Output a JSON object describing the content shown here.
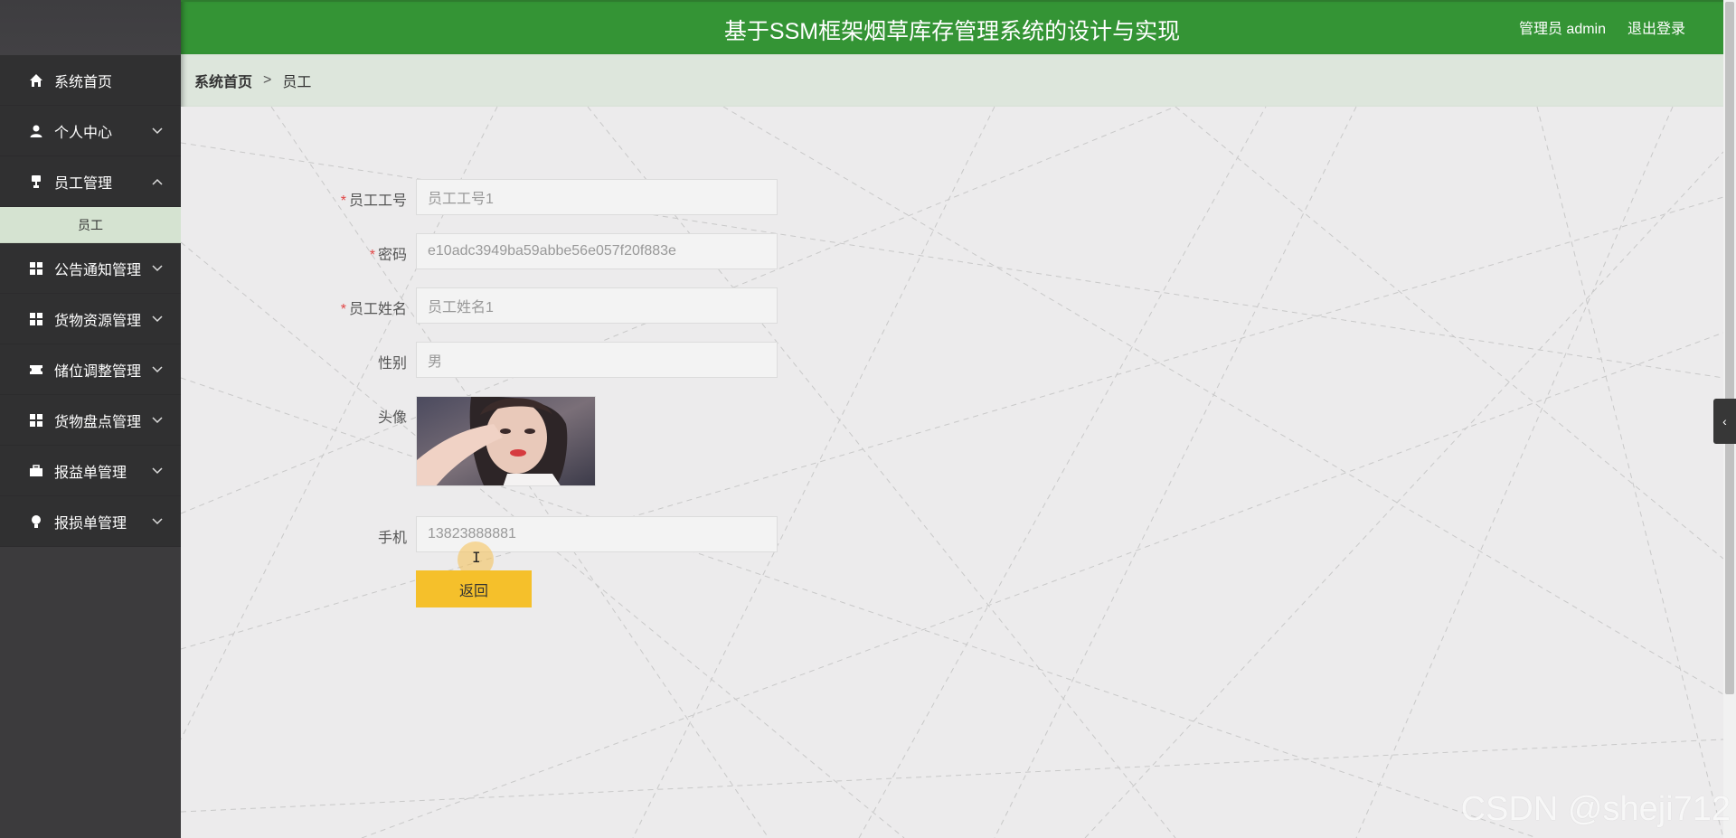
{
  "header": {
    "title": "基于SSM框架烟草库存管理系统的设计与实现",
    "user": "管理员 admin",
    "logout": "退出登录"
  },
  "sidebar": {
    "items": [
      {
        "label": "系统首页",
        "icon": "home-icon",
        "expanded": null
      },
      {
        "label": "个人中心",
        "icon": "user-icon",
        "expanded": false
      },
      {
        "label": "员工管理",
        "icon": "trophy-icon",
        "expanded": true
      },
      {
        "label": "公告通知管理",
        "icon": "grid-icon",
        "expanded": false
      },
      {
        "label": "货物资源管理",
        "icon": "grid-icon",
        "expanded": false
      },
      {
        "label": "储位调整管理",
        "icon": "ticket-icon",
        "expanded": false
      },
      {
        "label": "货物盘点管理",
        "icon": "grid-icon",
        "expanded": false
      },
      {
        "label": "报益单管理",
        "icon": "briefcase-icon",
        "expanded": false
      },
      {
        "label": "报损单管理",
        "icon": "bulb-icon",
        "expanded": false
      }
    ],
    "submenu": {
      "label": "员工"
    }
  },
  "breadcrumb": {
    "home": "系统首页",
    "separator": ">",
    "current": "员工"
  },
  "form": {
    "employee_no": {
      "label": "员工工号",
      "value": "员工工号1",
      "required": true
    },
    "password": {
      "label": "密码",
      "value": "e10adc3949ba59abbe56e057f20f883e",
      "required": true
    },
    "employee_name": {
      "label": "员工姓名",
      "value": "员工姓名1",
      "required": true
    },
    "gender": {
      "label": "性别",
      "value": "男",
      "required": false
    },
    "avatar": {
      "label": "头像"
    },
    "phone": {
      "label": "手机",
      "value": "13823888881",
      "required": false
    },
    "back_label": "返回"
  },
  "required_mark": "*",
  "collapse_glyph": "‹",
  "watermark": "CSDN @sheji712",
  "colors": {
    "header_green": "#349435",
    "sidebar_dark": "#303031",
    "submenu_bg": "#d5e3d1",
    "button_yellow": "#f5c02b",
    "required_red": "#e04545"
  }
}
